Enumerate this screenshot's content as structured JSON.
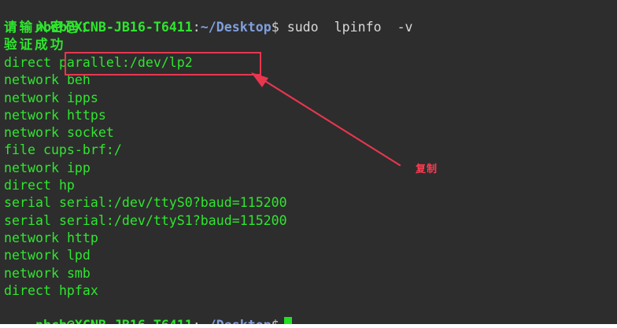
{
  "prompt": {
    "user_host": "nbcb@XCNB-JB16-T6411",
    "separator": ":",
    "path": "~/Desktop",
    "dollar": "$"
  },
  "command": "sudo  lpinfo  -v",
  "password_prompt": "请输入密码：",
  "auth_success": "验证成功",
  "output": [
    {
      "prefix": "direct ",
      "value": "parallel:/dev/lp2"
    },
    {
      "prefix": "network ",
      "value": "beh"
    },
    {
      "prefix": "network ",
      "value": "ipps"
    },
    {
      "prefix": "network ",
      "value": "https"
    },
    {
      "prefix": "network ",
      "value": "socket"
    },
    {
      "prefix": "file ",
      "value": "cups-brf:/"
    },
    {
      "prefix": "network ",
      "value": "ipp"
    },
    {
      "prefix": "direct ",
      "value": "hp"
    },
    {
      "prefix": "serial ",
      "value": "serial:/dev/ttyS0?baud=115200"
    },
    {
      "prefix": "serial ",
      "value": "serial:/dev/ttyS1?baud=115200"
    },
    {
      "prefix": "network ",
      "value": "http"
    },
    {
      "prefix": "network ",
      "value": "lpd"
    },
    {
      "prefix": "network ",
      "value": "smb"
    },
    {
      "prefix": "direct ",
      "value": "hpfax"
    }
  ],
  "annotation": {
    "label": "复制",
    "color": "#ff3b52"
  },
  "colors": {
    "terminal_bg": "#2d2d2d",
    "text_green": "#2ee62e",
    "path_blue": "#7f9fde",
    "highlight_red": "#e8364e"
  }
}
